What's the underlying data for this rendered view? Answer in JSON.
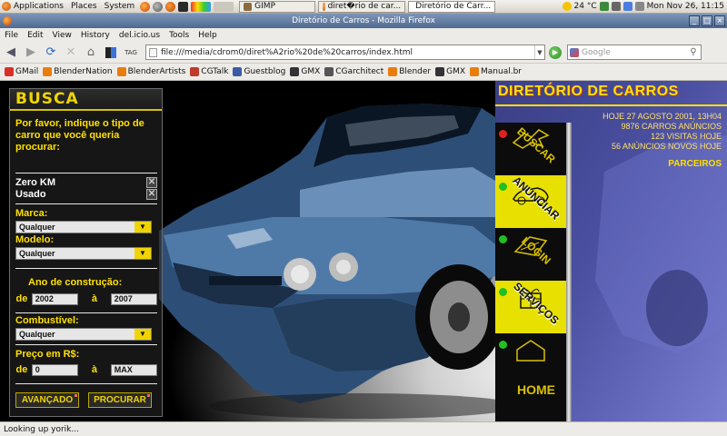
{
  "panel": {
    "menus": [
      "Applications",
      "Places",
      "System"
    ],
    "tasks": [
      {
        "label": "GIMP",
        "active": false
      },
      {
        "label": "diret�rio de car...",
        "active": false
      },
      {
        "label": "Diretório de Carr...",
        "active": true
      }
    ],
    "weather": "24 °C",
    "clock": "Mon Nov 26, 11:15"
  },
  "window": {
    "title": "Diretório de Carros - Mozilla Firefox"
  },
  "menubar": [
    "File",
    "Edit",
    "View",
    "History",
    "del.icio.us",
    "Tools",
    "Help"
  ],
  "navbar": {
    "url": "file:///media/cdrom0/diret%A2rio%20de%20carros/index.html",
    "search_placeholder": "Google",
    "tag_label": "TAG"
  },
  "bookmarks": [
    {
      "label": "GMail",
      "color": "#d93025"
    },
    {
      "label": "BlenderNation",
      "color": "#e87d0d"
    },
    {
      "label": "BlenderArtists",
      "color": "#e87d0d"
    },
    {
      "label": "CGTalk",
      "color": "#c0392b"
    },
    {
      "label": "Guestblog",
      "color": "#3b5ba5"
    },
    {
      "label": "GMX",
      "color": "#333333"
    },
    {
      "label": "CGarchitect",
      "color": "#555555"
    },
    {
      "label": "Blender",
      "color": "#e87d0d"
    },
    {
      "label": "GMX",
      "color": "#333333"
    },
    {
      "label": "Manual.br",
      "color": "#e87d0d"
    }
  ],
  "busca": {
    "title": "BUSCA",
    "intro": "Por favor, indique o tipo de carro que você queria procurar:",
    "options": [
      {
        "label": "Zero KM",
        "checked": true
      },
      {
        "label": "Usado",
        "checked": true
      }
    ],
    "marca": {
      "label": "Marca:",
      "value": "Qualquer"
    },
    "modelo": {
      "label": "Modelo:",
      "value": "Qualquer"
    },
    "ano": {
      "label": "Ano de construção:",
      "from_label": "de",
      "from": "2002",
      "to_label": "à",
      "to": "2007"
    },
    "combustivel": {
      "label": "Combustível:",
      "value": "Qualquer"
    },
    "preco": {
      "label": "Preço em R$:",
      "from_label": "de",
      "from": "0",
      "to_label": "à",
      "to": "MAX"
    },
    "btn_avancado": "AVANÇADO",
    "btn_procurar": "PROCURAR"
  },
  "right": {
    "title": "DIRETÓRIO DE CARROS",
    "stats": [
      "HOJE 27 AGOSTO 2001, 13H04",
      "9876 CARROS ANÚNCIOS",
      "123 VISITAS HOJE",
      "56 ANÚNCIOS NOVOS HOJE"
    ],
    "parceiros": "PARCEIROS",
    "nav": [
      {
        "label": "BUSCAR",
        "style": "black",
        "led": "#e02020"
      },
      {
        "label": "ANUNCIAR",
        "style": "yellow",
        "led": "#20c020"
      },
      {
        "label": "LOGIN",
        "style": "black",
        "led": "#20c020"
      },
      {
        "label": "SERVIÇOS",
        "style": "yellow",
        "led": "#20c020"
      },
      {
        "label": "HOME",
        "style": "black",
        "led": "#20c020"
      }
    ]
  },
  "status": "Looking up yorik..."
}
